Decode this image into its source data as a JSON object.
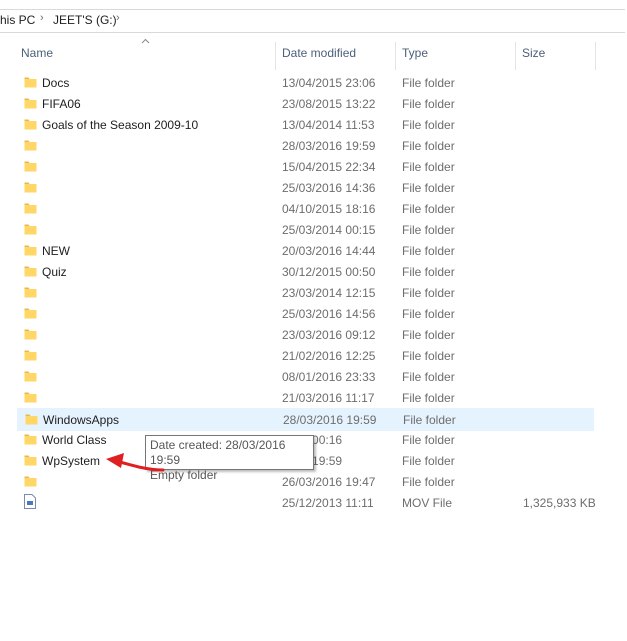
{
  "breadcrumb": {
    "items": [
      "his PC",
      "JEET'S (G:)"
    ]
  },
  "columns": {
    "name": "Name",
    "date_modified": "Date modified",
    "type": "Type",
    "size": "Size"
  },
  "files": [
    {
      "name": "Docs",
      "date": "13/04/2015 23:06",
      "type": "File folder",
      "size": "",
      "icon": "folder-icon"
    },
    {
      "name": "FIFA06",
      "date": "23/08/2015 13:22",
      "type": "File folder",
      "size": "",
      "icon": "folder-icon"
    },
    {
      "name": "Goals of the Season 2009-10",
      "date": "13/04/2014 11:53",
      "type": "File folder",
      "size": "",
      "icon": "folder-icon"
    },
    {
      "name": "",
      "date": "28/03/2016 19:59",
      "type": "File folder",
      "size": "",
      "icon": "folder-icon"
    },
    {
      "name": "",
      "date": "15/04/2015 22:34",
      "type": "File folder",
      "size": "",
      "icon": "folder-icon"
    },
    {
      "name": "",
      "date": "25/03/2016 14:36",
      "type": "File folder",
      "size": "",
      "icon": "folder-icon"
    },
    {
      "name": "",
      "date": "04/10/2015 18:16",
      "type": "File folder",
      "size": "",
      "icon": "folder-icon"
    },
    {
      "name": "",
      "date": "25/03/2014 00:15",
      "type": "File folder",
      "size": "",
      "icon": "folder-icon"
    },
    {
      "name": "NEW",
      "date": "20/03/2016 14:44",
      "type": "File folder",
      "size": "",
      "icon": "folder-icon"
    },
    {
      "name": "Quiz",
      "date": "30/12/2015 00:50",
      "type": "File folder",
      "size": "",
      "icon": "folder-icon"
    },
    {
      "name": "",
      "date": "23/03/2014 12:15",
      "type": "File folder",
      "size": "",
      "icon": "folder-icon"
    },
    {
      "name": "",
      "date": "25/03/2016 14:56",
      "type": "File folder",
      "size": "",
      "icon": "folder-icon"
    },
    {
      "name": "",
      "date": "23/03/2016 09:12",
      "type": "File folder",
      "size": "",
      "icon": "folder-icon"
    },
    {
      "name": "",
      "date": "21/02/2016 12:25",
      "type": "File folder",
      "size": "",
      "icon": "folder-icon"
    },
    {
      "name": "",
      "date": "08/01/2016 23:33",
      "type": "File folder",
      "size": "",
      "icon": "folder-icon"
    },
    {
      "name": "",
      "date": "21/03/2016 11:17",
      "type": "File folder",
      "size": "",
      "icon": "folder-icon"
    },
    {
      "name": "WindowsApps",
      "date": "28/03/2016 19:59",
      "type": "File folder",
      "size": "",
      "icon": "folder-icon",
      "hover": true
    },
    {
      "name": "World Class",
      "date": "2014 00:16",
      "type": "File folder",
      "size": "",
      "icon": "folder-icon"
    },
    {
      "name": "WpSystem",
      "date": "2016 19:59",
      "type": "File folder",
      "size": "",
      "icon": "folder-icon"
    },
    {
      "name": "",
      "date": "26/03/2016 19:47",
      "type": "File folder",
      "size": "",
      "icon": "folder-icon"
    },
    {
      "name": "",
      "date": "25/12/2013 11:11",
      "type": "MOV File",
      "size": "1,325,933 KB",
      "icon": "mov-file-icon"
    }
  ],
  "tooltip": {
    "line1": "Date created: 28/03/2016 19:59",
    "line2": "Empty folder"
  },
  "colors": {
    "folder": "#ffd766",
    "folder_tab": "#e8b84a",
    "hover_row": "#e5f3ff",
    "annotation_arrow": "#e02020",
    "header_text": "#4c607a"
  }
}
